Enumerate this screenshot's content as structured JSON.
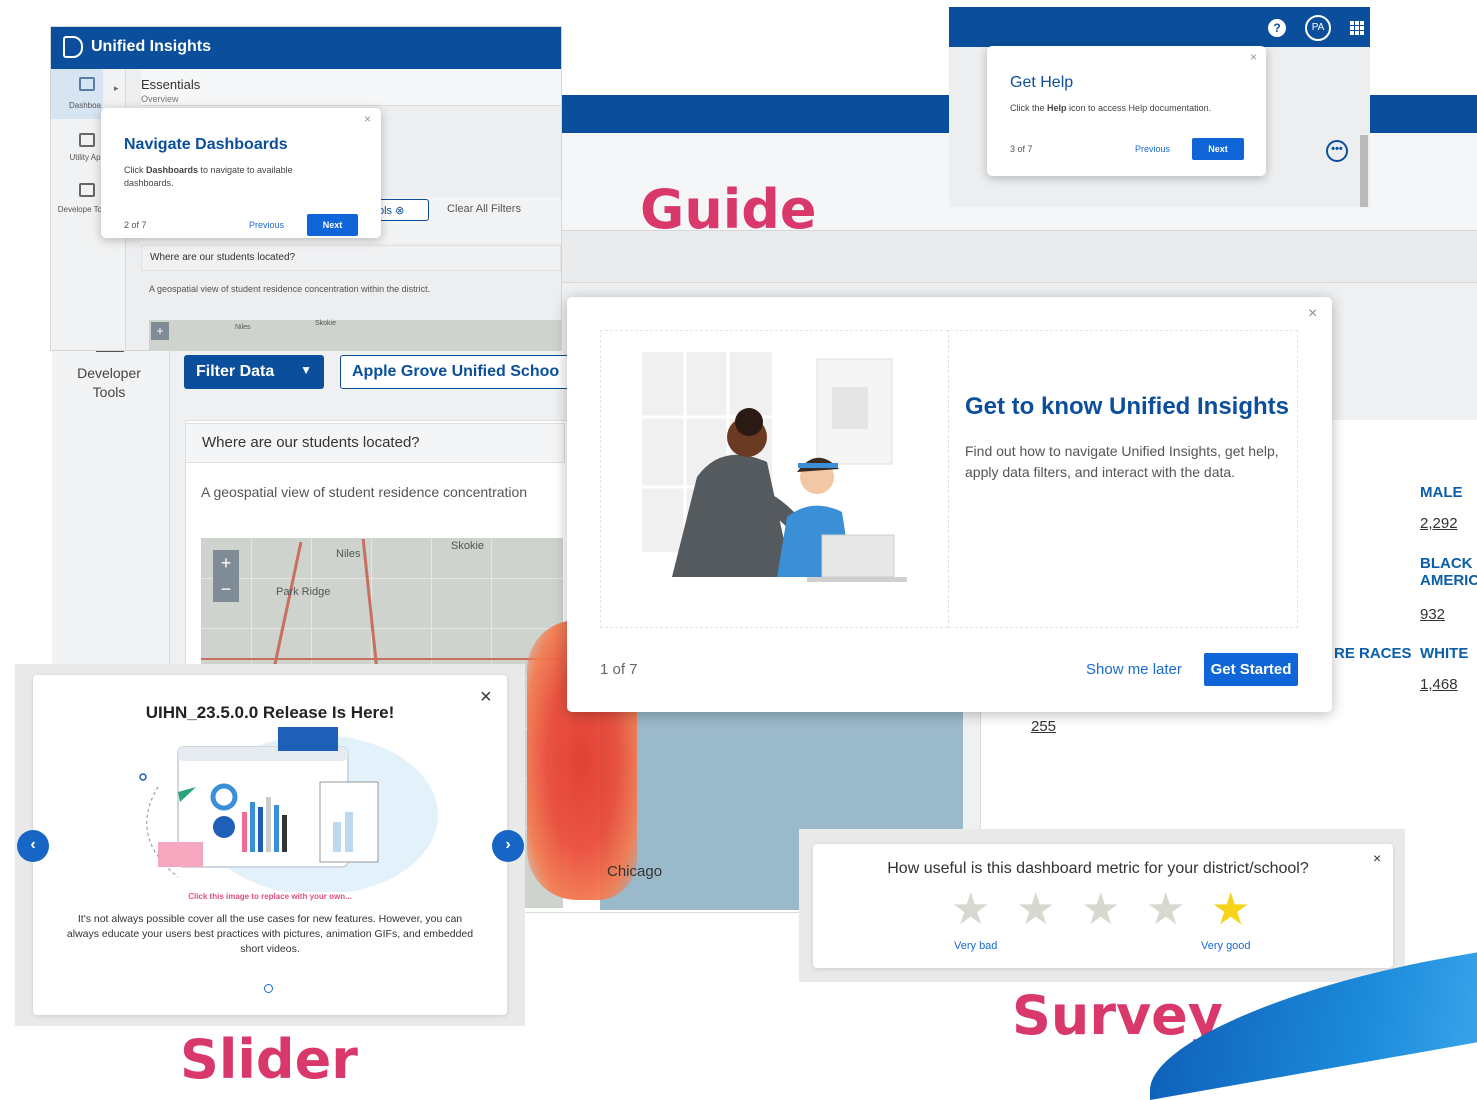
{
  "colors": {
    "primary": "#0b4f9c",
    "button": "#1066d8",
    "tag": "#d8386a",
    "star_active": "#f7d419",
    "star_inactive": "#d6d9cf"
  },
  "top_left_window": {
    "app_title": "Unified Insights",
    "breadcrumb_title": "Essentials",
    "breadcrumb_sub": "Overview",
    "sidebar": [
      {
        "label": "Dashboa",
        "icon": "dashboard-icon"
      },
      {
        "label": "Utility Ap",
        "icon": "briefcase-icon"
      },
      {
        "label": "Develope Tools",
        "icon": "code-icon"
      }
    ],
    "chip_label": "ols",
    "clear_all": "Clear All Filters",
    "card_title": "Where are our students located?",
    "card_desc": "A geospatial view of student residence concentration within the district.",
    "map_labels": [
      "Niles",
      "Skokie"
    ],
    "tooltip": {
      "heading": "Navigate Dashboards",
      "body_pre": "Click ",
      "body_bold": "Dashboards",
      "body_post": " to navigate to available dashboards.",
      "step": "2 of 7",
      "prev": "Previous",
      "next": "Next"
    }
  },
  "top_right_window": {
    "avatar": "PA",
    "help_icon_glyph": "?",
    "tooltip": {
      "heading": "Get Help",
      "body_pre": "Click the ",
      "body_bold": "Help",
      "body_post": " icon to access Help documentation.",
      "step": "3 of 7",
      "prev": "Previous",
      "next": "Next"
    }
  },
  "tags": {
    "guide": "Guide",
    "slider": "Slider",
    "survey": "Survey"
  },
  "dashboard": {
    "dev_tools_label": "Developer Tools",
    "filter_button": "Filter Data",
    "school_chip": "Apple Grove Unified Schoo",
    "card_title": "Where are our students located?",
    "card_desc": "A geospatial view of student residence concentration",
    "map_labels": [
      "Niles",
      "Skokie",
      "Park Ridge",
      "Chicago"
    ],
    "metrics": [
      {
        "label": "MALE",
        "value": "2,292"
      },
      {
        "label": "BLACK AMERIC",
        "value": "932"
      },
      {
        "label": "RE RACES",
        "value": ""
      },
      {
        "label": "WHITE",
        "value": "1,468"
      }
    ],
    "extra_value": "255"
  },
  "modal": {
    "heading": "Get to know Unified Insights",
    "body": "Find out how to navigate Unified Insights, get help, apply data filters, and interact with the data.",
    "step": "1 of 7",
    "later": "Show me later",
    "start": "Get Started"
  },
  "slider": {
    "title": "UIHN_23.5.0.0 Release Is Here!",
    "caption": "Click this image to replace with your own...",
    "body": "It's not always possible cover all the use cases for new features. However, you can always educate your users best practices with pictures, animation GIFs, and embedded short videos."
  },
  "survey": {
    "question": "How useful is this dashboard metric for your district/school?",
    "low_label": "Very bad",
    "high_label": "Very good",
    "rating": 5,
    "max_rating": 5
  }
}
